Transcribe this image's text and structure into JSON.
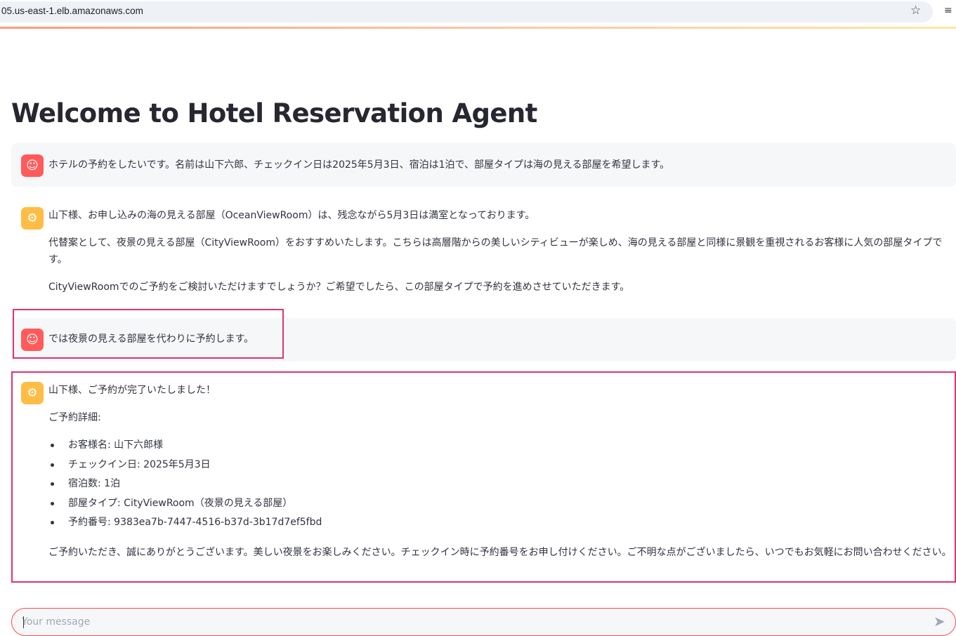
{
  "browser": {
    "url": "05.us-east-1.elb.amazonaws.com",
    "star_icon": "star-outline-icon",
    "menu_icon": "reading-list-icon"
  },
  "page": {
    "title": "Welcome to Hotel Reservation Agent"
  },
  "messages": [
    {
      "role": "user",
      "avatar_icon": "user-face-icon",
      "paragraphs": [
        "ホテルの予約をしたいです。名前は山下六郎、チェックイン日は2025年5月3日、宿泊は1泊で、部屋タイプは海の見える部屋を希望します。"
      ]
    },
    {
      "role": "assistant",
      "avatar_icon": "robot-icon",
      "paragraphs": [
        "山下様、お申し込みの海の見える部屋（OceanViewRoom）は、残念ながら5月3日は満室となっております。",
        "代替案として、夜景の見える部屋（CityViewRoom）をおすすめいたします。こちらは高層階からの美しいシティビューが楽しめ、海の見える部屋と同様に景観を重視されるお客様に人気の部屋タイプです。",
        "CityViewRoomでのご予約をご検討いただけますでしょうか？ご希望でしたら、この部屋タイプで予約を進めさせていただきます。"
      ]
    },
    {
      "role": "user",
      "avatar_icon": "user-face-icon",
      "paragraphs": [
        "では夜景の見える部屋を代わりに予約します。"
      ]
    },
    {
      "role": "assistant",
      "avatar_icon": "robot-icon",
      "intro": "山下様、ご予約が完了いたしました！",
      "details_label": "ご予約詳細:",
      "details": [
        "お客様名: 山下六郎様",
        "チェックイン日: 2025年5月3日",
        "宿泊数: 1泊",
        "部屋タイプ: CityViewRoom（夜景の見える部屋）",
        "予約番号: 9383ea7b-7447-4516-b37d-3b17d7ef5fbd"
      ],
      "closing": "ご予約いただき、誠にありがとうございます。美しい夜景をお楽しみください。チェックイン時に予約番号をお申し付けください。ご不明な点がございましたら、いつでもお気軽にお問い合わせください。"
    }
  ],
  "chat_input": {
    "placeholder": "Your message",
    "value": "",
    "send_icon": "send-arrow-icon"
  },
  "colors": {
    "user_avatar": "#ff5b5b",
    "assistant_avatar": "#ffbd45",
    "highlight_border": "#e0336f",
    "input_border": "#ff4b4b"
  }
}
